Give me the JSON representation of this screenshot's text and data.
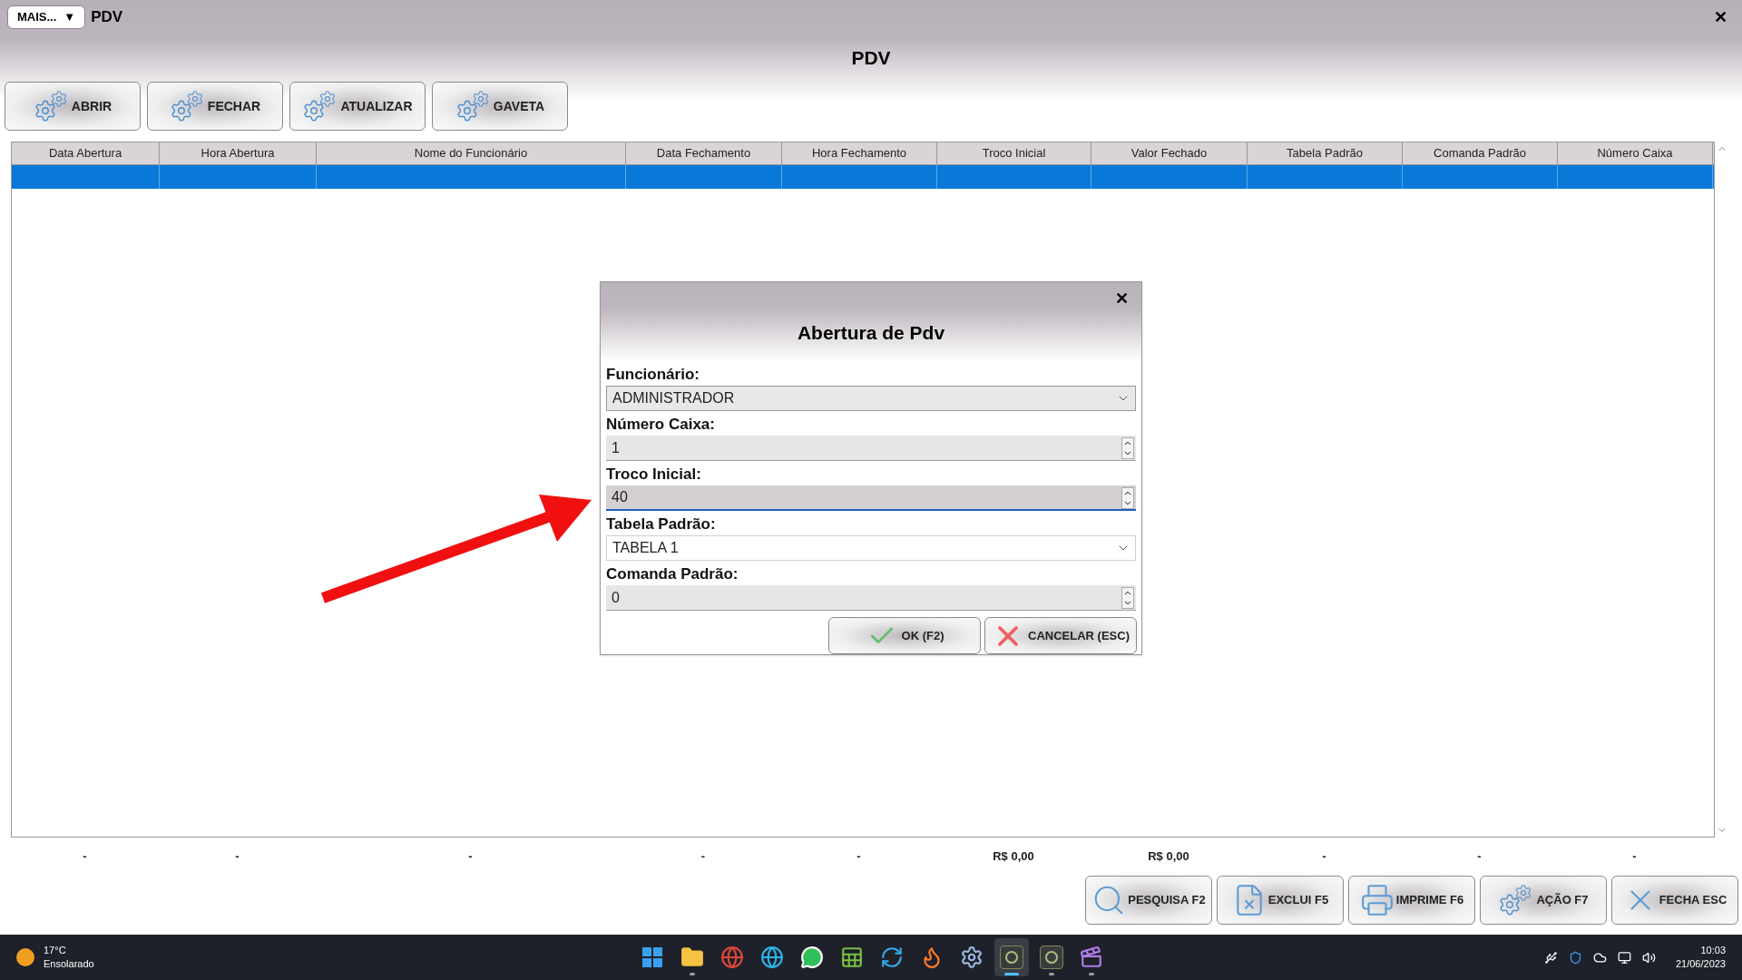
{
  "window": {
    "menu_button": "MAIS...",
    "menu_caret": "▼",
    "title": "PDV",
    "close": "✕"
  },
  "header": {
    "title": "PDV"
  },
  "toolbar": [
    {
      "label": "ABRIR"
    },
    {
      "label": "FECHAR"
    },
    {
      "label": "ATUALIZAR"
    },
    {
      "label": "GAVETA"
    }
  ],
  "table": {
    "columns": [
      "Data Abertura",
      "Hora Abertura",
      "Nome do Funcionário",
      "Data Fechamento",
      "Hora Fechamento",
      "Troco Inicial",
      "Valor Fechado",
      "Tabela Padrão",
      "Comanda Padrão",
      "Número Caixa"
    ],
    "rows": [
      {
        "selected": true
      }
    ]
  },
  "totals": [
    "-",
    "-",
    "-",
    "-",
    "-",
    "R$ 0,00",
    "R$ 0,00",
    "-",
    "-",
    "-"
  ],
  "actions": [
    {
      "kind": "search",
      "label": "PESQUISA F2"
    },
    {
      "kind": "delete",
      "label": "EXCLUI F5"
    },
    {
      "kind": "print",
      "label": "IMPRIME F6"
    },
    {
      "kind": "gear",
      "label": "AÇÃO F7"
    },
    {
      "kind": "close",
      "label": "FECHA ESC"
    }
  ],
  "dialog": {
    "title": "Abertura de Pdv",
    "close": "✕",
    "fields": [
      {
        "kind": "dropdown",
        "label": "Funcionário:",
        "value": "ADMINISTRADOR"
      },
      {
        "kind": "number",
        "label": "Número Caixa:",
        "value": "1",
        "focused": false
      },
      {
        "kind": "number",
        "label": "Troco Inicial:",
        "value": "40",
        "focused": true
      },
      {
        "kind": "combobox",
        "label": "Tabela Padrão:",
        "value": "TABELA 1"
      },
      {
        "kind": "number",
        "label": "Comanda Padrão:",
        "value": "0",
        "focused": false
      }
    ],
    "buttons": [
      {
        "kind": "ok",
        "label": "OK (F2)"
      },
      {
        "kind": "cancel",
        "label": "CANCELAR (ESC)"
      }
    ]
  },
  "taskbar": {
    "temperature": "17°C",
    "condition": "Ensolarado",
    "apps": [
      {
        "kind": "start",
        "running": false,
        "selected": false
      },
      {
        "kind": "folder",
        "running": true,
        "selected": false
      },
      {
        "kind": "chrome",
        "running": false,
        "selected": false
      },
      {
        "kind": "edge",
        "running": false,
        "selected": false
      },
      {
        "kind": "whatsapp",
        "running": false,
        "selected": false
      },
      {
        "kind": "sheet",
        "running": false,
        "selected": false
      },
      {
        "kind": "sync",
        "running": false,
        "selected": false
      },
      {
        "kind": "firefox",
        "running": false,
        "selected": false
      },
      {
        "kind": "gear",
        "running": false,
        "selected": false
      },
      {
        "kind": "s-app",
        "running": true,
        "selected": true
      },
      {
        "kind": "s-app",
        "running": true,
        "selected": false
      },
      {
        "kind": "clapper",
        "running": true,
        "selected": false
      }
    ],
    "time": "10:03",
    "date": "21/06/2023"
  }
}
